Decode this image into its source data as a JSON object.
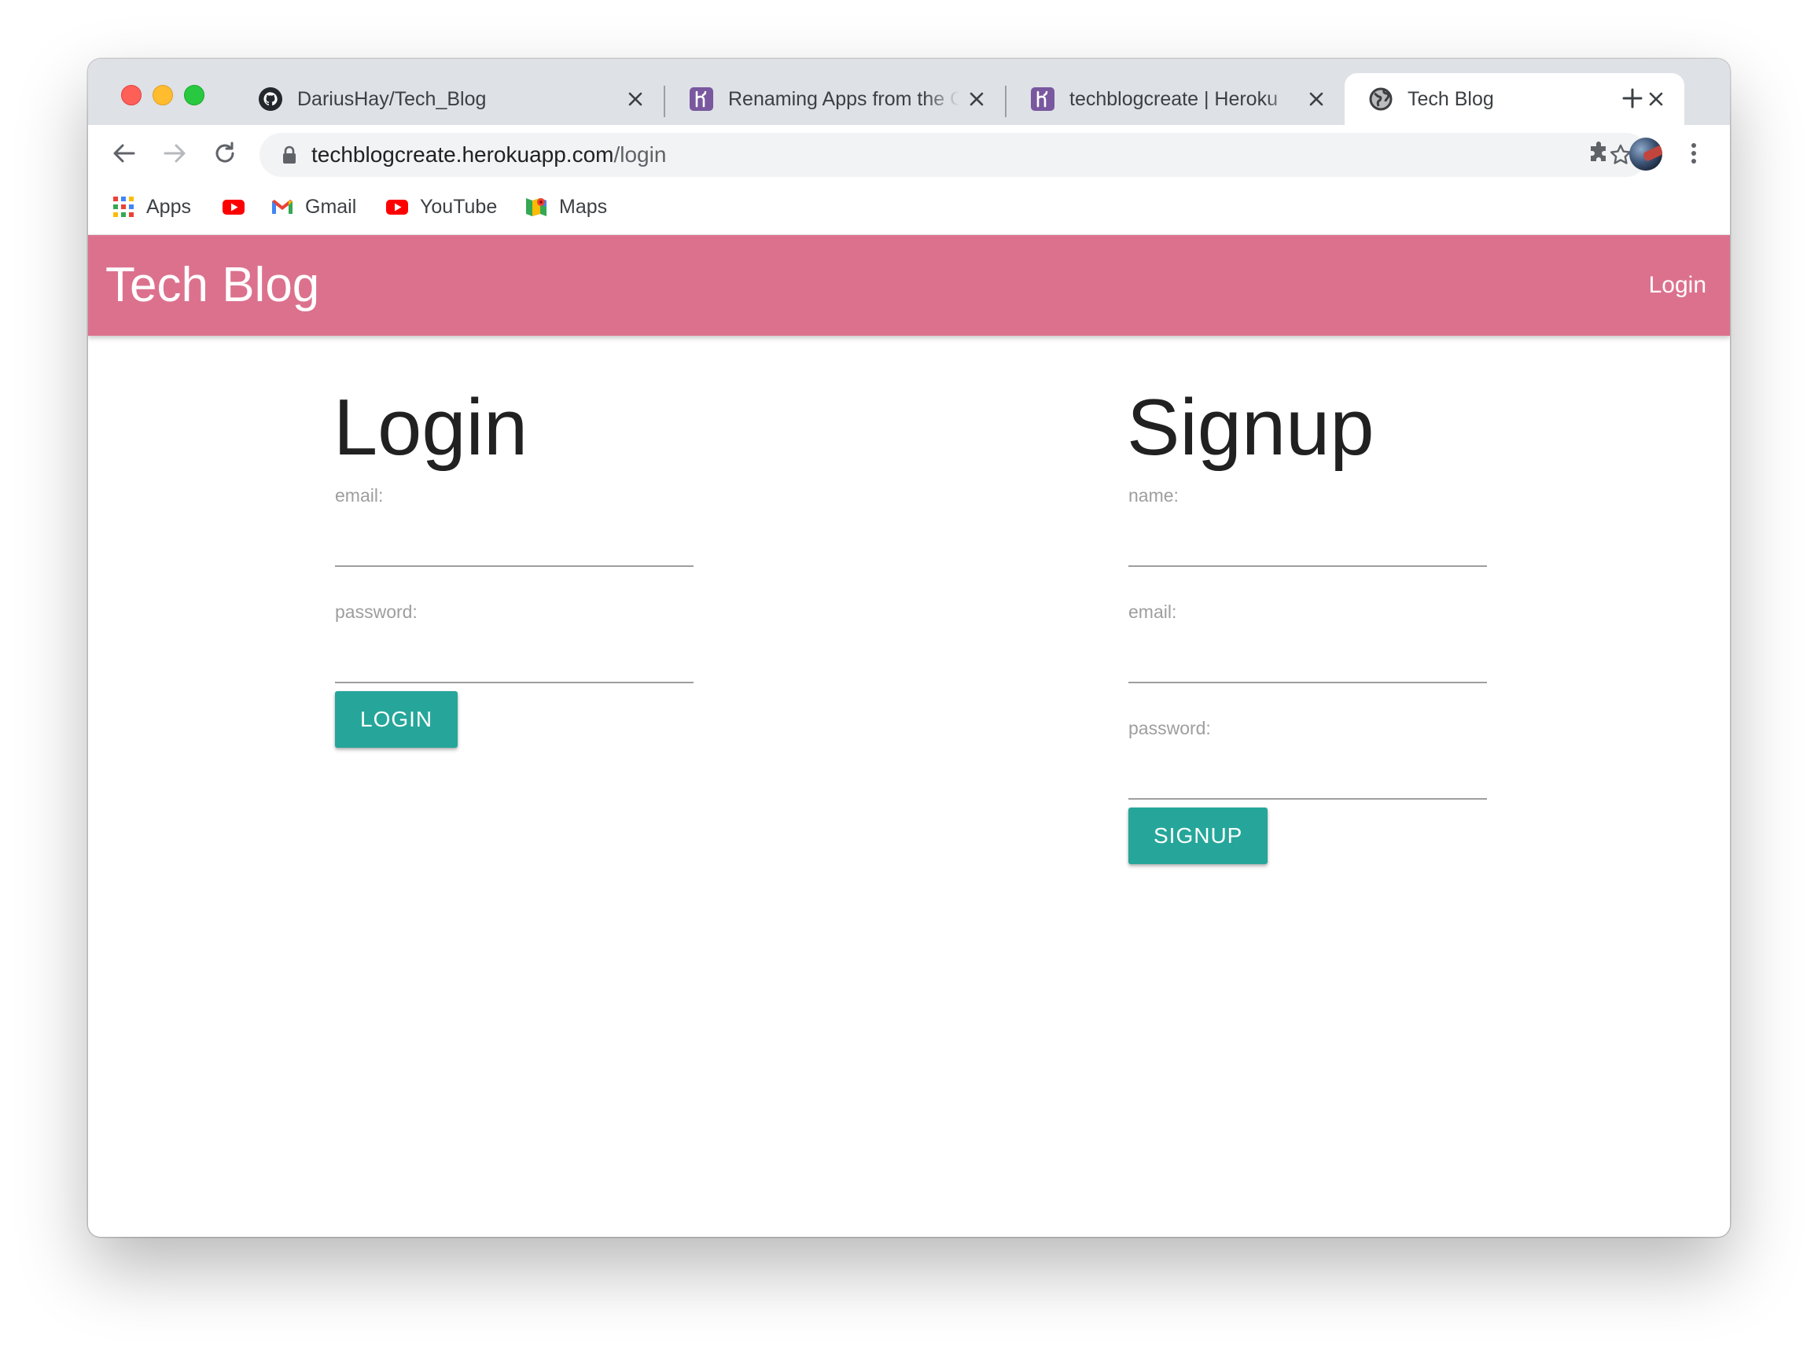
{
  "browser": {
    "tabs": [
      {
        "label": "DariusHay/Tech_Blog",
        "icon": "github-icon",
        "active": false
      },
      {
        "label": "Renaming Apps from the CLI",
        "icon": "heroku-icon",
        "active": false
      },
      {
        "label": "techblogcreate | Heroku",
        "icon": "heroku-icon",
        "active": false
      },
      {
        "label": "Tech Blog",
        "icon": "globe-icon",
        "active": true
      }
    ],
    "url_host": "techblogcreate.herokuapp.com",
    "url_path": "/login",
    "bookmarks": [
      {
        "label": "Apps",
        "icon": "apps-grid-icon"
      },
      {
        "label": "",
        "icon": "youtube-icon"
      },
      {
        "label": "Gmail",
        "icon": "gmail-icon"
      },
      {
        "label": "YouTube",
        "icon": "youtube-icon"
      },
      {
        "label": "Maps",
        "icon": "maps-icon"
      }
    ]
  },
  "site": {
    "brand": "Tech Blog",
    "nav_login": "Login",
    "brand_color": "#dc718e",
    "accent_color": "#26a69a"
  },
  "login_form": {
    "title": "Login",
    "email_label": "email:",
    "password_label": "password:",
    "button": "LOGIN"
  },
  "signup_form": {
    "title": "Signup",
    "name_label": "name:",
    "email_label": "email:",
    "password_label": "password:",
    "button": "SIGNUP"
  }
}
